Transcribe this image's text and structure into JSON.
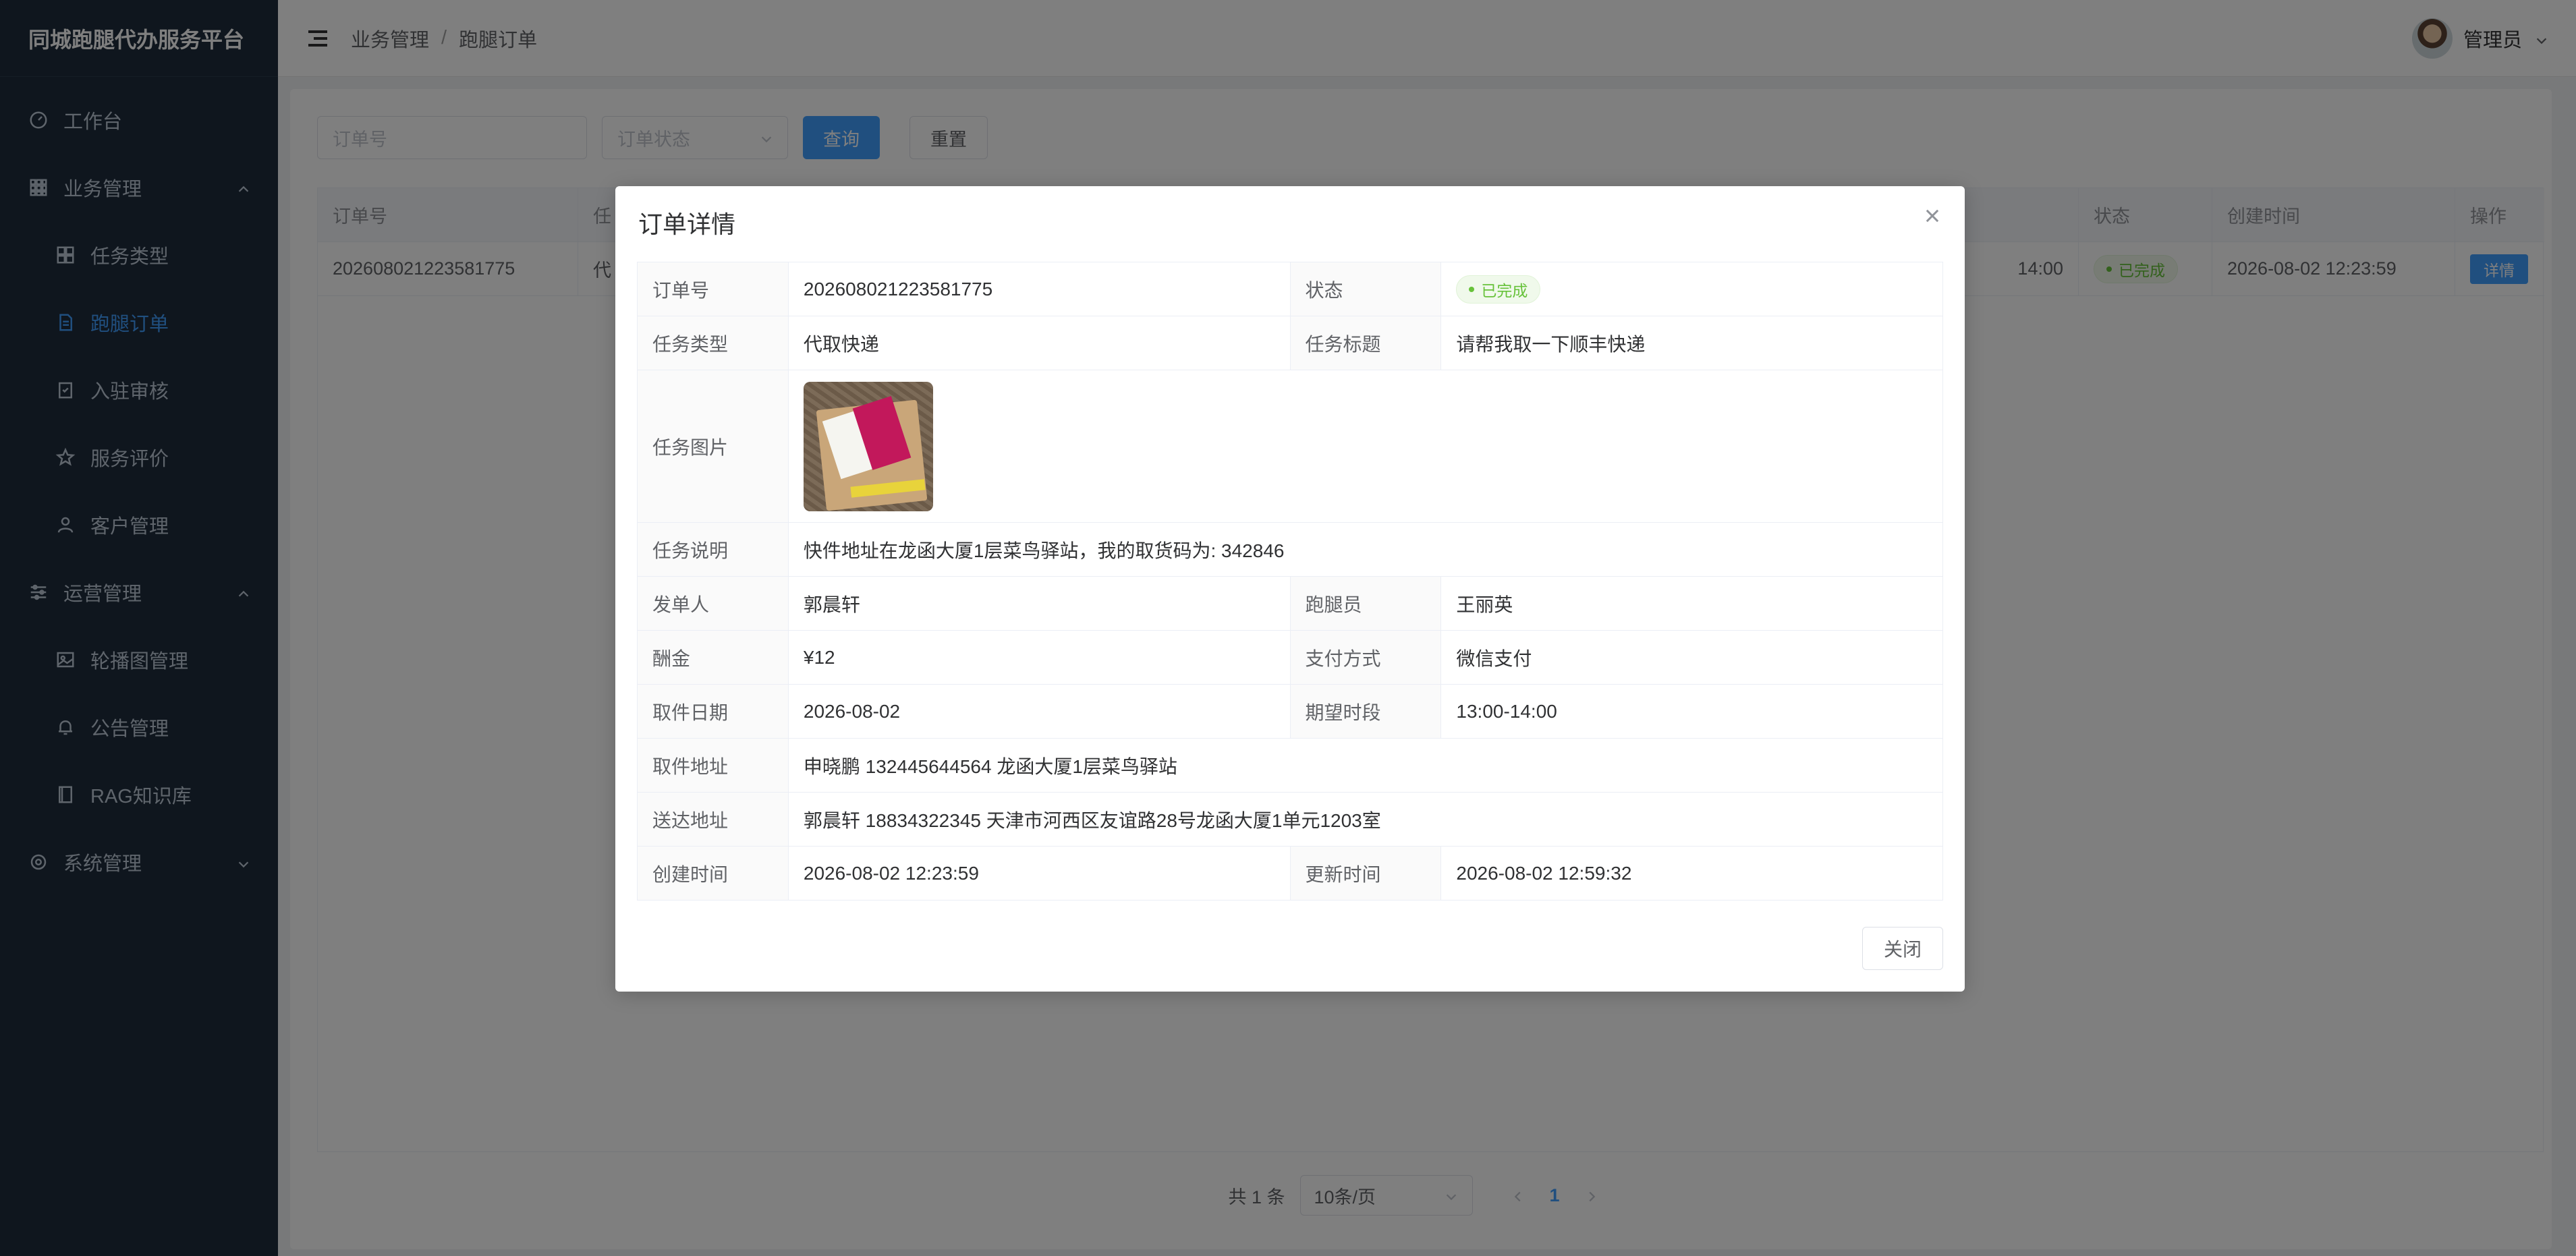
{
  "app": {
    "title": "同城跑腿代办服务平台"
  },
  "sidebar": {
    "items": [
      {
        "label": "工作台"
      },
      {
        "label": "业务管理"
      },
      {
        "label": "任务类型"
      },
      {
        "label": "跑腿订单"
      },
      {
        "label": "入驻审核"
      },
      {
        "label": "服务评价"
      },
      {
        "label": "客户管理"
      },
      {
        "label": "运营管理"
      },
      {
        "label": "轮播图管理"
      },
      {
        "label": "公告管理"
      },
      {
        "label": "RAG知识库"
      },
      {
        "label": "系统管理"
      }
    ]
  },
  "header": {
    "breadcrumb": [
      "业务管理",
      "跑腿订单"
    ],
    "breadcrumb_sep": "/",
    "user": "管理员"
  },
  "toolbar": {
    "order_placeholder": "订单号",
    "status_placeholder": "订单状态",
    "search_label": "查询",
    "reset_label": "重置"
  },
  "table": {
    "headers": {
      "order_no": "订单号",
      "col2": "任",
      "status": "状态",
      "created": "创建时间",
      "ops": "操作"
    },
    "row": {
      "order_no": "202608021223581775",
      "col2": "代",
      "period_tail": "14:00",
      "status": "已完成",
      "created": "2026-08-02 12:23:59",
      "action": "详情"
    }
  },
  "pager": {
    "total": "共 1 条",
    "page_size": "10条/页",
    "current": "1"
  },
  "dialog": {
    "title": "订单详情",
    "fields": {
      "order_no_label": "订单号",
      "order_no": "202608021223581775",
      "status_label": "状态",
      "status": "已完成",
      "type_label": "任务类型",
      "type": "代取快递",
      "task_title_label": "任务标题",
      "task_title": "请帮我取一下顺丰快递",
      "image_label": "任务图片",
      "desc_label": "任务说明",
      "desc": "快件地址在龙函大厦1层菜鸟驿站，我的取货码为: 342846",
      "sender_label": "发单人",
      "sender": "郭晨轩",
      "runner_label": "跑腿员",
      "runner": "王丽英",
      "reward_label": "酬金",
      "reward": "¥12",
      "pay_label": "支付方式",
      "pay": "微信支付",
      "pickup_date_label": "取件日期",
      "pickup_date": "2026-08-02",
      "period_label": "期望时段",
      "period": "13:00-14:00",
      "pickup_addr_label": "取件地址",
      "pickup_addr": "申晓鹏 132445644564 龙函大厦1层菜鸟驿站",
      "delivery_addr_label": "送达地址",
      "delivery_addr": "郭晨轩 18834322345 天津市河西区友谊路28号龙函大厦1单元1203室",
      "created_label": "创建时间",
      "created": "2026-08-02 12:23:59",
      "updated_label": "更新时间",
      "updated": "2026-08-02 12:59:32"
    },
    "close_label": "关闭"
  }
}
